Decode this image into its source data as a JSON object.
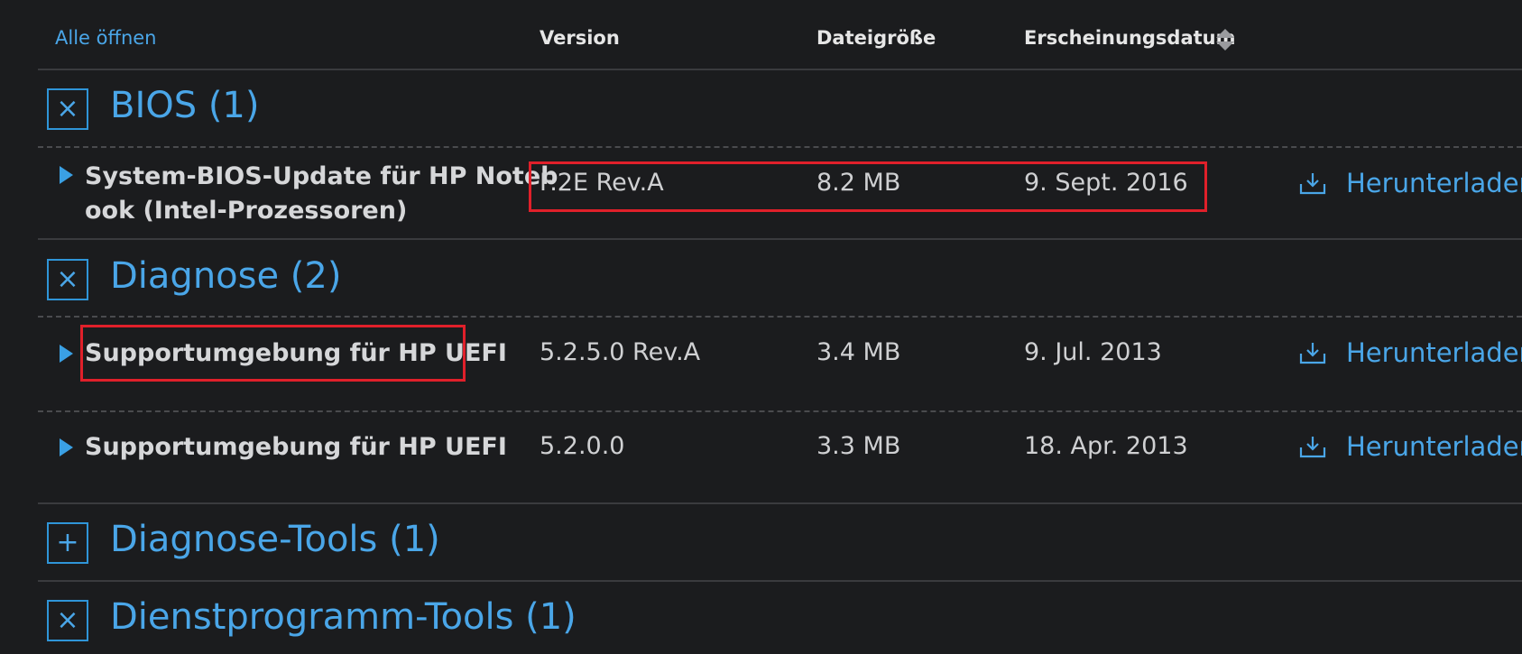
{
  "header": {
    "open_all": "Alle öffnen",
    "version": "Version",
    "file_size": "Dateigröße",
    "release_date": "Erscheinungsdatum"
  },
  "categories": [
    {
      "title": "BIOS (1)",
      "toggle": "×",
      "items": [
        {
          "name_line1": "System-BIOS-Update für HP Noteb",
          "name_line2": "ook (Intel-Prozessoren)",
          "version": "F.2E Rev.A",
          "size": "8.2 MB",
          "date": "9. Sept. 2016",
          "download": "Herunterladen"
        }
      ]
    },
    {
      "title": "Diagnose (2)",
      "toggle": "×",
      "items": [
        {
          "name": "Supportumgebung für HP UEFI",
          "version": "5.2.5.0 Rev.A",
          "size": "3.4 MB",
          "date": "9. Jul. 2013",
          "download": "Herunterladen"
        },
        {
          "name": "Supportumgebung für HP UEFI",
          "version": "5.2.0.0",
          "size": "3.3 MB",
          "date": "18. Apr. 2013",
          "download": "Herunterladen"
        }
      ]
    },
    {
      "title": "Diagnose-Tools (1)",
      "toggle": "+"
    },
    {
      "title": "Dienstprogramm-Tools (1)",
      "toggle": "×"
    }
  ],
  "colors": {
    "background": "#1b1c1e",
    "accent": "#4aa6e8",
    "highlight": "#e0202a"
  }
}
